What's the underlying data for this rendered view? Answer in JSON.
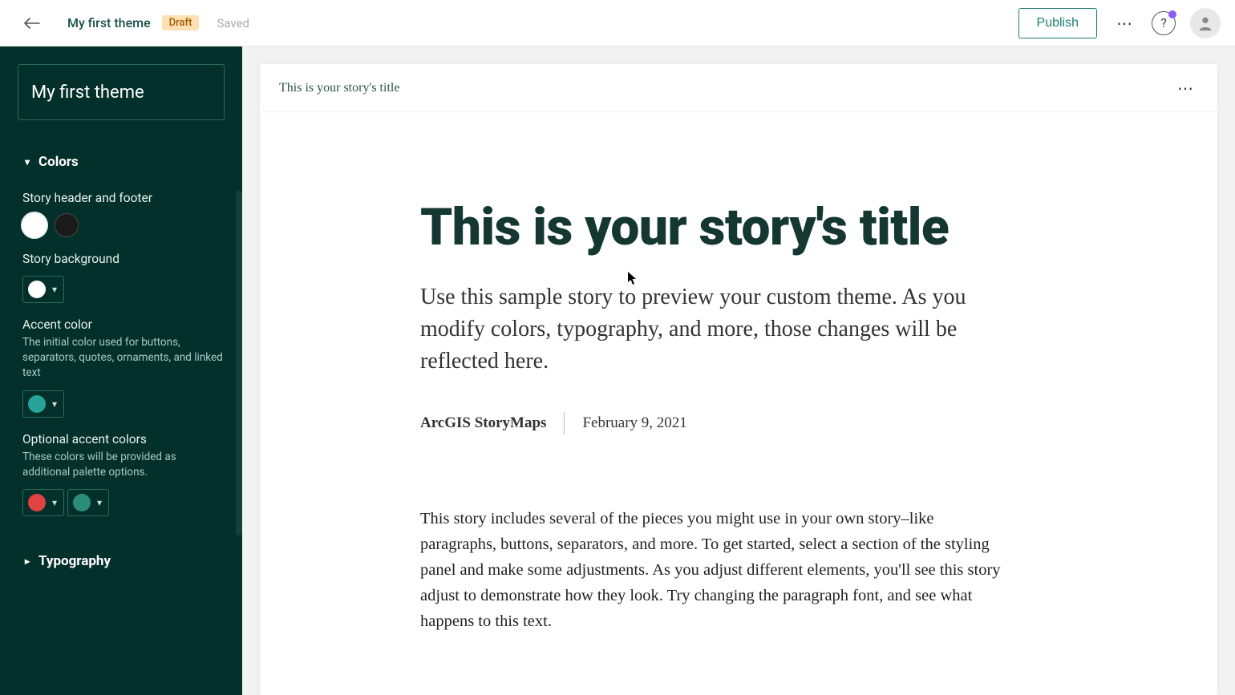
{
  "header": {
    "theme_title": "My first theme",
    "badge": "Draft",
    "saved": "Saved",
    "publish": "Publish"
  },
  "sidebar": {
    "theme_name": "My first theme",
    "colors_section": "Colors",
    "typography_section": "Typography",
    "header_footer_label": "Story header and footer",
    "background_label": "Story background",
    "accent_label": "Accent color",
    "accent_desc": "The initial color used for buttons, separators, quotes, ornaments, and linked text",
    "optional_label": "Optional accent colors",
    "optional_desc": "These colors will be provided as additional palette options.",
    "colors": {
      "background": "#ffffff",
      "accent": "#29a39a",
      "optional1": "#e14242",
      "optional2": "#2c8d7c"
    }
  },
  "preview": {
    "header_title": "This is your story's title",
    "title": "This is your story's title",
    "subtitle": "Use this sample story to preview your custom theme. As you modify colors, typography, and more, those changes will be reflected here.",
    "author": "ArcGIS StoryMaps",
    "date": "February 9, 2021",
    "paragraph": "This story includes several of the pieces you might use in your own story–like paragraphs, buttons, separators, and more. To get started, select a section of the styling panel and make some adjustments. As you adjust different elements, you'll see this story adjust to demonstrate how they look. Try changing the paragraph font, and see what happens to this text."
  }
}
